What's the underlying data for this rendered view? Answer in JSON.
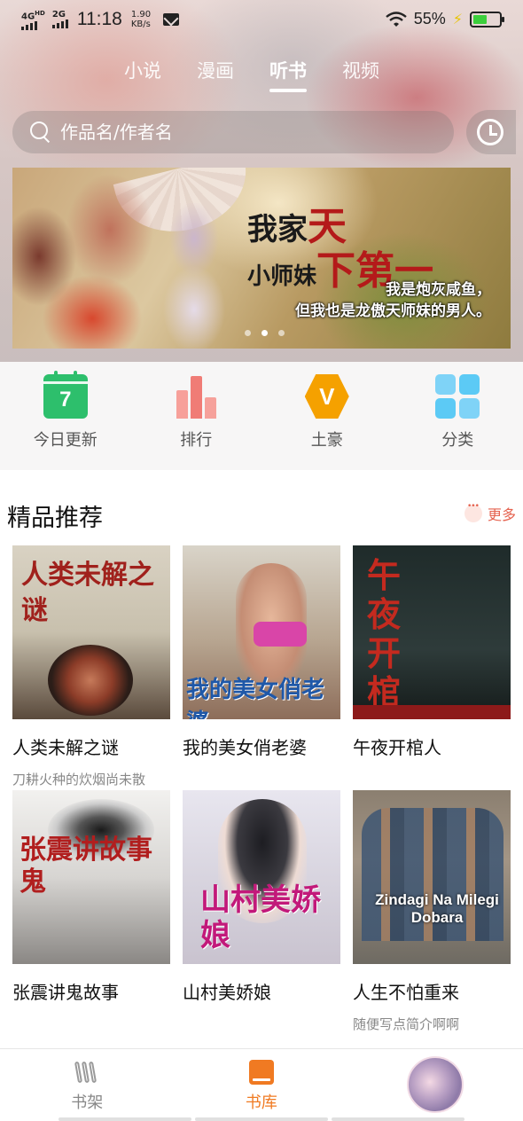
{
  "status_bar": {
    "network1": "4G",
    "network1_sup": "HD",
    "network2": "2G",
    "time": "11:18",
    "speed_value": "1.90",
    "speed_unit": "KB/s",
    "battery_percent": "55%",
    "battery_level": 0.55,
    "icons": [
      "signal-icon",
      "mail-icon",
      "wifi-icon",
      "charging-icon",
      "battery-icon"
    ]
  },
  "top_tabs": {
    "items": [
      {
        "label": "小说",
        "active": false
      },
      {
        "label": "漫画",
        "active": false
      },
      {
        "label": "听书",
        "active": true
      },
      {
        "label": "视频",
        "active": false
      }
    ]
  },
  "search": {
    "placeholder": "作品名/作者名"
  },
  "banner": {
    "title_part1": "我家",
    "title_part2": "天",
    "subtitle_part1": "小师妹",
    "subtitle_part2": "下第一",
    "caption_line1": "我是炮灰咸鱼，",
    "caption_line2": "但我也是龙傲天师妹的男人。",
    "slide_count": 3,
    "active_slide": 2
  },
  "quick_nav": {
    "items": [
      {
        "label": "今日更新",
        "icon": "calendar-icon",
        "badge": "7"
      },
      {
        "label": "排行",
        "icon": "ranking-icon"
      },
      {
        "label": "土豪",
        "icon": "vip-icon",
        "badge": "V"
      },
      {
        "label": "分类",
        "icon": "category-icon"
      }
    ]
  },
  "section": {
    "title": "精品推荐",
    "more_label": "更多"
  },
  "books": [
    {
      "title": "人类未解之谜",
      "desc": "刀耕火种的炊烟尚未散",
      "cover_text": "人类未解之谜"
    },
    {
      "title": "我的美女俏老婆",
      "desc": "",
      "cover_text": "我的美女俏老婆"
    },
    {
      "title": "午夜开棺人",
      "desc": "",
      "cover_text": "午夜开棺人"
    },
    {
      "title": "张震讲鬼故事",
      "desc": "",
      "cover_text": "张震讲故事 鬼"
    },
    {
      "title": "山村美娇娘",
      "desc": "",
      "cover_text": "山村美娇娘"
    },
    {
      "title": "人生不怕重来",
      "desc": "随便写点简介啊啊",
      "cover_text": "Zindagi Na Milegi Dobara"
    }
  ],
  "bottom_nav": {
    "items": [
      {
        "label": "书架",
        "icon": "bookshelf-icon",
        "active": false
      },
      {
        "label": "书库",
        "icon": "library-icon",
        "active": true
      },
      {
        "label": "",
        "icon": "avatar",
        "active": false
      }
    ]
  },
  "colors": {
    "accent": "#f07a22",
    "more_link": "#e5614e",
    "calendar_green": "#2dbf6c",
    "vip_orange": "#f5a100",
    "category_blue": "#5ccaf5",
    "ranking_red": "#f07c76"
  }
}
